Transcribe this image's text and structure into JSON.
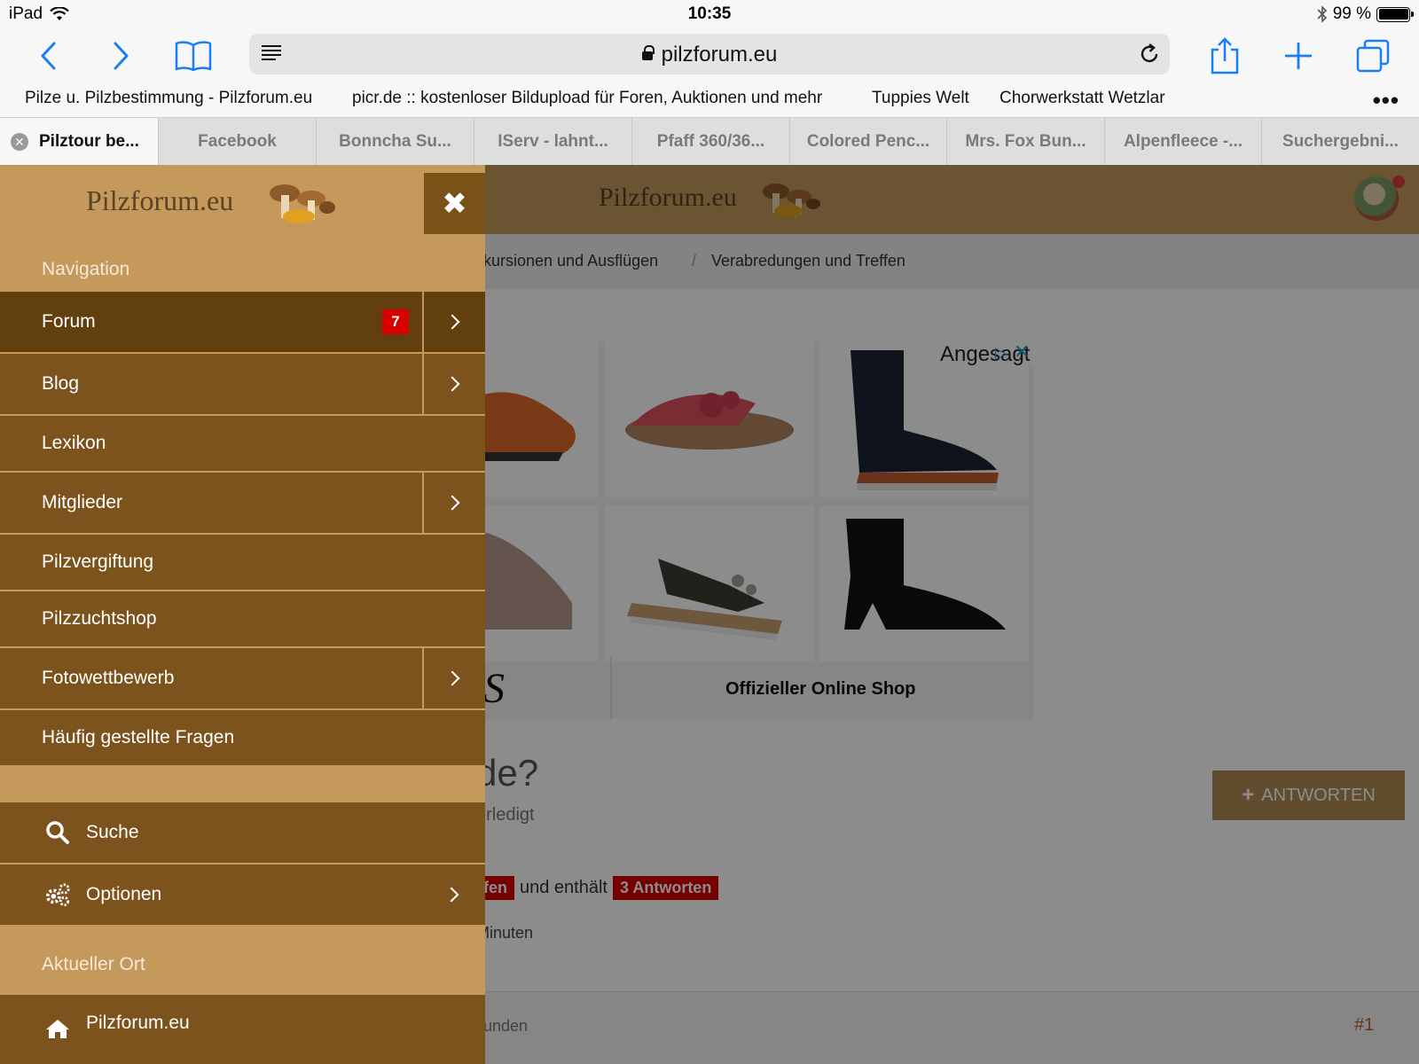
{
  "status_bar": {
    "device": "iPad",
    "time": "10:35",
    "battery": "99 %",
    "battery_level": 0.99
  },
  "browser": {
    "url": "pilzforum.eu",
    "icons": {
      "back": "chevron-left-icon",
      "forward": "chevron-right-icon",
      "bookmarks": "book-icon",
      "reader": "reader-icon",
      "lock": "lock-icon",
      "reload": "reload-icon",
      "share": "share-icon",
      "new_tab": "plus-icon",
      "tabs": "tabs-icon"
    },
    "favorites": [
      "Pilze u. Pilzbestimmung - Pilzforum.eu",
      "picr.de :: kostenloser Bildupload für Foren, Auktionen und mehr",
      "Tuppies Welt",
      "Chorwerkstatt Wetzlar"
    ],
    "favorites_more": "•••",
    "tabs": [
      "Pilztour be...",
      "Facebook",
      "Bonncha Su...",
      "IServ - lahnt...",
      "Pfaff 360/36...",
      "Colored Penc...",
      "Mrs. Fox Bun...",
      "Alpenfleece -...",
      "Suchergebni..."
    ]
  },
  "site": {
    "logo": "Pilzforum.eu",
    "breadcrumb": [
      "kursionen und Ausflügen",
      "Verabredungen und Treffen"
    ],
    "breadcrumb_sep": "/",
    "ad": {
      "label": "Angesagt",
      "choices": "▷",
      "close": "✕",
      "brand_letter": "S",
      "shop_label": "Offizieller Online Shop"
    },
    "thread": {
      "title_partial": "de?",
      "status_partial": "erledigt",
      "info_badge_partial": "fen",
      "info_text": "und enthält",
      "replies_badge": "3 Antworten",
      "time_partial": "Minuten",
      "reply_button": "ANTWORTEN",
      "post_time_partial": "unden",
      "post_number": "#1"
    }
  },
  "menu": {
    "logo": "Pilzforum.eu",
    "close": "✖",
    "section_navigation": "Navigation",
    "items": [
      {
        "label": "Forum",
        "count": "7",
        "has_submenu": true,
        "active": true
      },
      {
        "label": "Blog",
        "has_submenu": true
      },
      {
        "label": "Lexikon"
      },
      {
        "label": "Mitglieder",
        "has_submenu": true
      },
      {
        "label": "Pilzvergiftung"
      },
      {
        "label": "Pilzzuchtshop"
      },
      {
        "label": "Fotowettbewerb",
        "has_submenu": true
      },
      {
        "label": "Häufig gestellte Fragen"
      }
    ],
    "search": {
      "label": "Suche",
      "icon": "search-icon"
    },
    "options": {
      "label": "Optionen",
      "icon": "gears-icon"
    },
    "section_location": "Aktueller Ort",
    "location": {
      "label": "Pilzforum.eu",
      "icon": "home-icon"
    }
  },
  "colors": {
    "menu_bg": "#c4995b",
    "menu_item": "#7d531d",
    "menu_item_active": "#623f0f",
    "badge": "#d60000",
    "ios_blue": "#1a7ff0"
  }
}
